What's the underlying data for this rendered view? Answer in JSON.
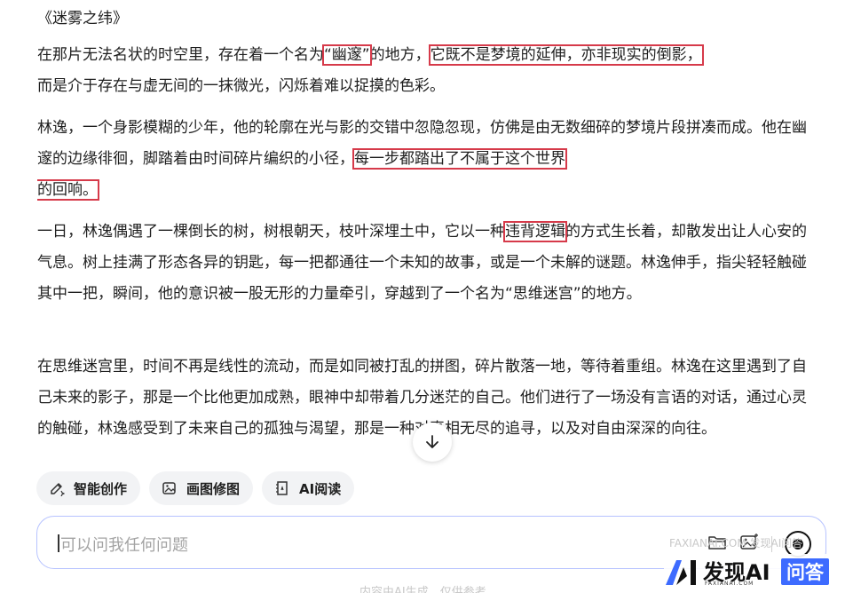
{
  "article": {
    "title": "《迷雾之纬》",
    "p1": {
      "a": "在那片无法名状的时空里，存在着一个名为",
      "h1": "“幽邃”",
      "b": "的地方，",
      "h2": "它既不是梦境的延伸，亦非现实的倒影，",
      "c": "而是介于存在与虚无间的一抹微光，闪烁着难以捉摸的色彩。"
    },
    "p2": {
      "a": "林逸，一个身影模糊的少年，他的轮廓在光与影的交错中忽隐忽现，仿佛是由无数细碎的梦境片段拼凑而成。他在幽邃的边缘徘徊，脚踏着由时间碎片编织的小径，",
      "h1": "每一步都踏出了不属于这个世界",
      "h2": "的回响。"
    },
    "p3": {
      "a": "一日，林逸偶遇了一棵倒长的树，树根朝天，枝叶深埋土中，它以一种",
      "h1": "违背逻辑",
      "b": "的方式生长着，却散发出让人心安的气息。树上挂满了形态各异的钥匙，每一把都通往一个未知的故事，或是一个未解的谜题。林逸伸手，指尖轻轻触碰其中一把，瞬间，他的意识被一股无形的力量牵引，穿越到了一个名为“思维迷宫”的地方。"
    },
    "p4": "在思维迷宫里，时间不再是线性的流动，而是如同被打乱的拼图，碎片散落一地，等待着重组。林逸在这里遇到了自己未来的影子，那是一个比他更加成熟，眼神中却带着几分迷茫的自己。他们进行了一场没有言语的对话，通过心灵的触碰，林逸感受到了未来自己的孤独与渴望，那是一种对真相无尽的追寻，以及对自由深深的向往。"
  },
  "actions": [
    {
      "label": "智能创作",
      "icon": "pen-sparkle-icon"
    },
    {
      "label": "画图修图",
      "icon": "image-edit-icon"
    },
    {
      "label": "AI阅读",
      "icon": "book-ai-icon"
    }
  ],
  "input": {
    "placeholder": "可以问我任何问题"
  },
  "disclaimer": "内容由AI生成，仅供参考",
  "watermark": {
    "under_text": "FAXIANAI.COM 发现AI问答",
    "brand_name": "发现AI",
    "brand_domain": "FAXIANAI.COM",
    "brand_badge": "问答"
  },
  "colors": {
    "highlight_border": "#d63a4a",
    "input_border": "#b7c3ff",
    "chip_bg": "#f2f3f5",
    "brand_badge_bg": "#3d6bff"
  }
}
